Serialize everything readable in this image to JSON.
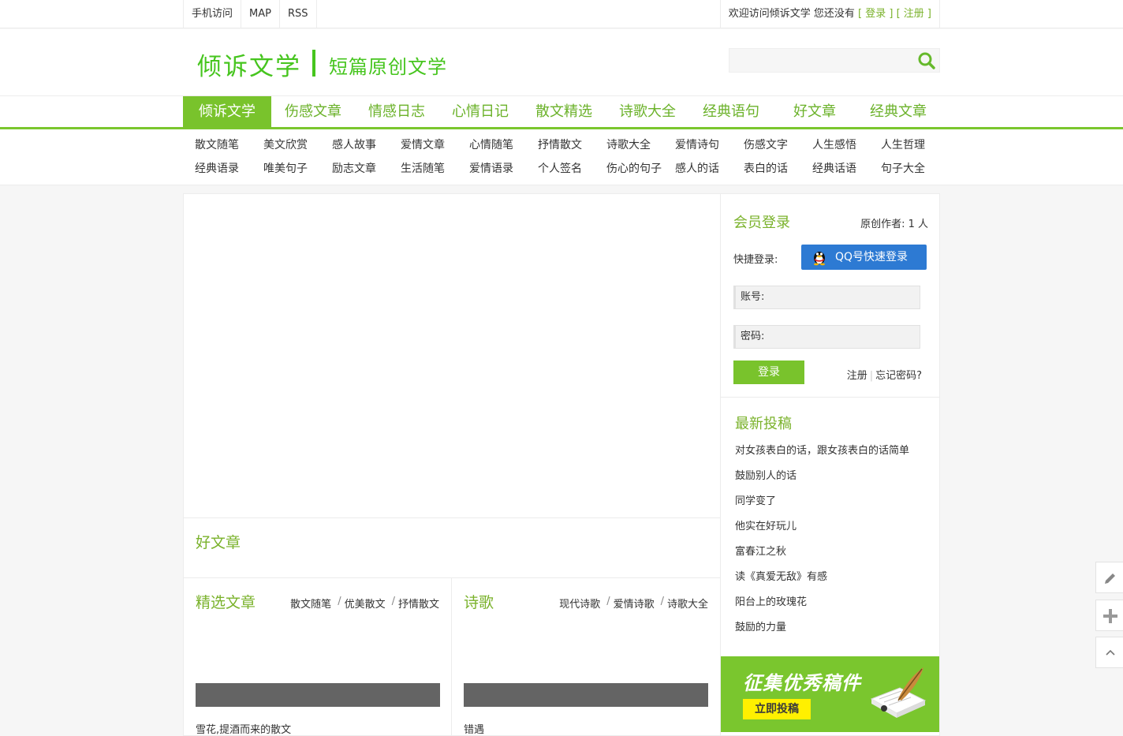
{
  "topbar": {
    "links": [
      "手机访问",
      "MAP",
      "RSS"
    ],
    "welcome": "欢迎访问倾诉文学 您还没有",
    "login": "[ 登录 ]",
    "register": "[ 注册 ]"
  },
  "header": {
    "logo": "倾诉文学",
    "slogan": "短篇原创文学",
    "search_placeholder": ""
  },
  "nav": {
    "items": [
      "倾诉文学",
      "伤感文章",
      "情感日志",
      "心情日记",
      "散文精选",
      "诗歌大全",
      "经典语句",
      "好文章",
      "经典文章"
    ]
  },
  "subnav": {
    "row1": [
      "散文随笔",
      "美文欣赏",
      "感人故事",
      "爱情文章",
      "心情随笔",
      "抒情散文",
      "诗歌大全",
      "爱情诗句",
      "伤感文字",
      "人生感悟",
      "人生哲理"
    ],
    "row2": [
      "经典语录",
      "唯美句子",
      "励志文章",
      "生活随笔",
      "爱情语录",
      "个人签名",
      "伤心的句子",
      "感人的话",
      "表白的话",
      "经典话语",
      "句子大全"
    ]
  },
  "main": {
    "good_title": "好文章",
    "col1": {
      "title": "精选文章",
      "links": [
        "散文随笔",
        "优美散文",
        "抒情散文"
      ],
      "caption": "雪花,提酒而来的散文"
    },
    "col2": {
      "title": "诗歌",
      "links": [
        "现代诗歌",
        "爱情诗歌",
        "诗歌大全"
      ],
      "caption": "错遇"
    }
  },
  "sidebar": {
    "login_title": "会员登录",
    "authors": "原创作者: 1 人",
    "quick_login": "快捷登录:",
    "qq_button": "QQ号快速登录",
    "account_label": "账号:",
    "password_label": "密码:",
    "login_button": "登录",
    "register": "注册",
    "forgot": "忘记密码?",
    "latest_title": "最新投稿",
    "latest": [
      "对女孩表白的话，跟女孩表白的话简单",
      "鼓励别人的话",
      "同学变了",
      "他实在好玩儿",
      "富春江之秋",
      "读《真爱无敌》有感",
      "阳台上的玫瑰花",
      "鼓励的力量"
    ],
    "promo_title": "征集优秀稿件",
    "promo_button": "立即投稿"
  },
  "tools": [
    "pencil-icon",
    "plus-icon",
    "chevron-up-icon"
  ],
  "colors": {
    "brand": "#79c32c",
    "text_green": "#7ab22b",
    "qq_blue": "#2d7ad3"
  }
}
